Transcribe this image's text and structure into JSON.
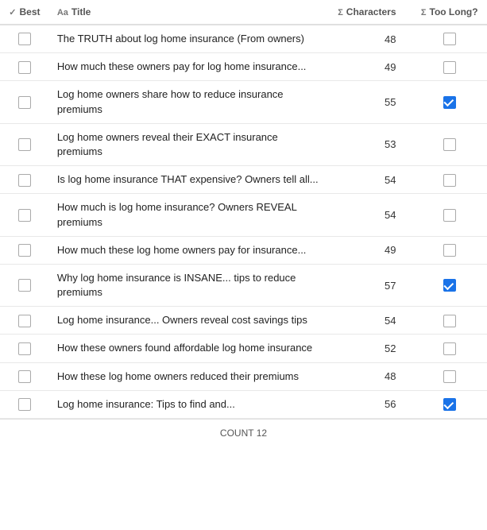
{
  "header": {
    "col_best": "Best",
    "col_title": "Title",
    "col_chars": "Characters",
    "col_toolong": "Too Long?"
  },
  "rows": [
    {
      "id": 1,
      "best_checked": false,
      "title": "The TRUTH about log home insurance (From owners)",
      "chars": 48,
      "toolong_checked": false
    },
    {
      "id": 2,
      "best_checked": false,
      "title": "How much these owners pay for log home insurance...",
      "chars": 49,
      "toolong_checked": false
    },
    {
      "id": 3,
      "best_checked": false,
      "title": "Log home owners share how to reduce insurance premiums",
      "chars": 55,
      "toolong_checked": true
    },
    {
      "id": 4,
      "best_checked": false,
      "title": "Log home owners reveal their EXACT insurance premiums",
      "chars": 53,
      "toolong_checked": false
    },
    {
      "id": 5,
      "best_checked": false,
      "title": "Is log home insurance THAT expensive? Owners tell all...",
      "chars": 54,
      "toolong_checked": false
    },
    {
      "id": 6,
      "best_checked": false,
      "title": "How much is log home insurance? Owners REVEAL premiums",
      "chars": 54,
      "toolong_checked": false
    },
    {
      "id": 7,
      "best_checked": false,
      "title": "How much these log home owners pay for insurance...",
      "chars": 49,
      "toolong_checked": false
    },
    {
      "id": 8,
      "best_checked": false,
      "title": "Why log home insurance is INSANE... tips to reduce premiums",
      "chars": 57,
      "toolong_checked": true
    },
    {
      "id": 9,
      "best_checked": false,
      "title": "Log home insurance...  Owners reveal cost savings tips",
      "chars": 54,
      "toolong_checked": false
    },
    {
      "id": 10,
      "best_checked": false,
      "title": "How these owners found affordable log home insurance",
      "chars": 52,
      "toolong_checked": false
    },
    {
      "id": 11,
      "best_checked": false,
      "title": "How these log home owners reduced their premiums",
      "chars": 48,
      "toolong_checked": false
    },
    {
      "id": 12,
      "best_checked": false,
      "title": "Log home insurance: Tips to find and...",
      "chars": 56,
      "toolong_checked": true
    }
  ],
  "count_label": "COUNT",
  "count_value": "12"
}
